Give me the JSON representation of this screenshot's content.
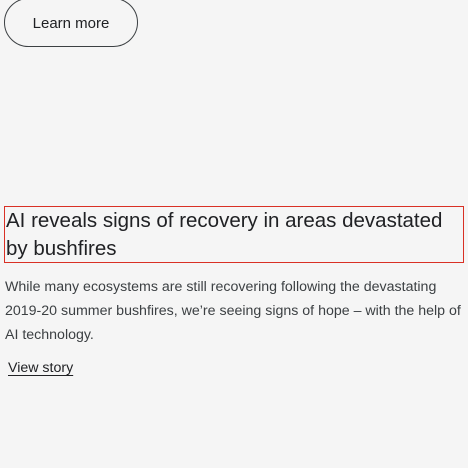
{
  "cta": {
    "learn_more_label": "Learn more"
  },
  "article": {
    "headline": "AI reveals signs of recovery in areas devastated by bushfires",
    "description": "While many ecosystems are still recovering following the devastating 2019-20 summer bushfires, we’re seeing signs of hope – with the help of AI technology.",
    "view_story_label": "View story"
  },
  "colors": {
    "background": "#f5f5f5",
    "text": "#202124",
    "highlight_border": "#d93025"
  }
}
